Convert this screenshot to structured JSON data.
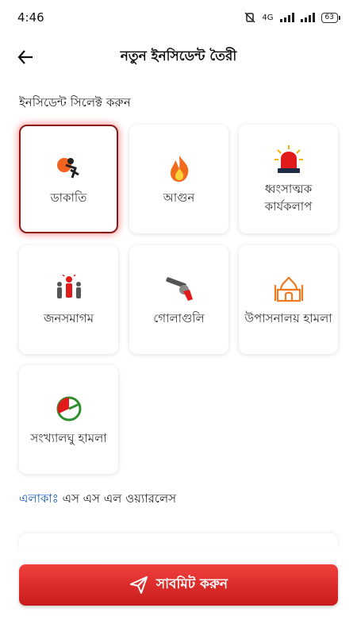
{
  "status": {
    "time": "4:46",
    "network": "4G",
    "battery": "63"
  },
  "header": {
    "title": "নতুন ইনসিডেন্ট তৈরী"
  },
  "section_label": "ইনসিডেন্ট সিলেক্ট করুন",
  "tiles": [
    {
      "label": "ডাকাতি",
      "icon": "robber-icon",
      "selected": true
    },
    {
      "label": "আগুন",
      "icon": "fire-icon",
      "selected": false
    },
    {
      "label": "ধ্বংসাত্মক কার্যকলাপ",
      "icon": "siren-icon",
      "selected": false
    },
    {
      "label": "জনসমাগম",
      "icon": "crowd-icon",
      "selected": false
    },
    {
      "label": "গোলাগুলি",
      "icon": "gun-icon",
      "selected": false
    },
    {
      "label": "উপাসনালয় হামলা",
      "icon": "mosque-icon",
      "selected": false
    },
    {
      "label": "সংখ্যালঘু হামলা",
      "icon": "pie-icon",
      "selected": false
    }
  ],
  "area": {
    "key": "এলাকাঃ",
    "value": "এস এস এল ওয়্যারলেস"
  },
  "submit_label": "সাবমিট করুন",
  "colors": {
    "accent": "#d72323",
    "selected_border": "#8b1a1a",
    "link": "#1a5bb5"
  }
}
